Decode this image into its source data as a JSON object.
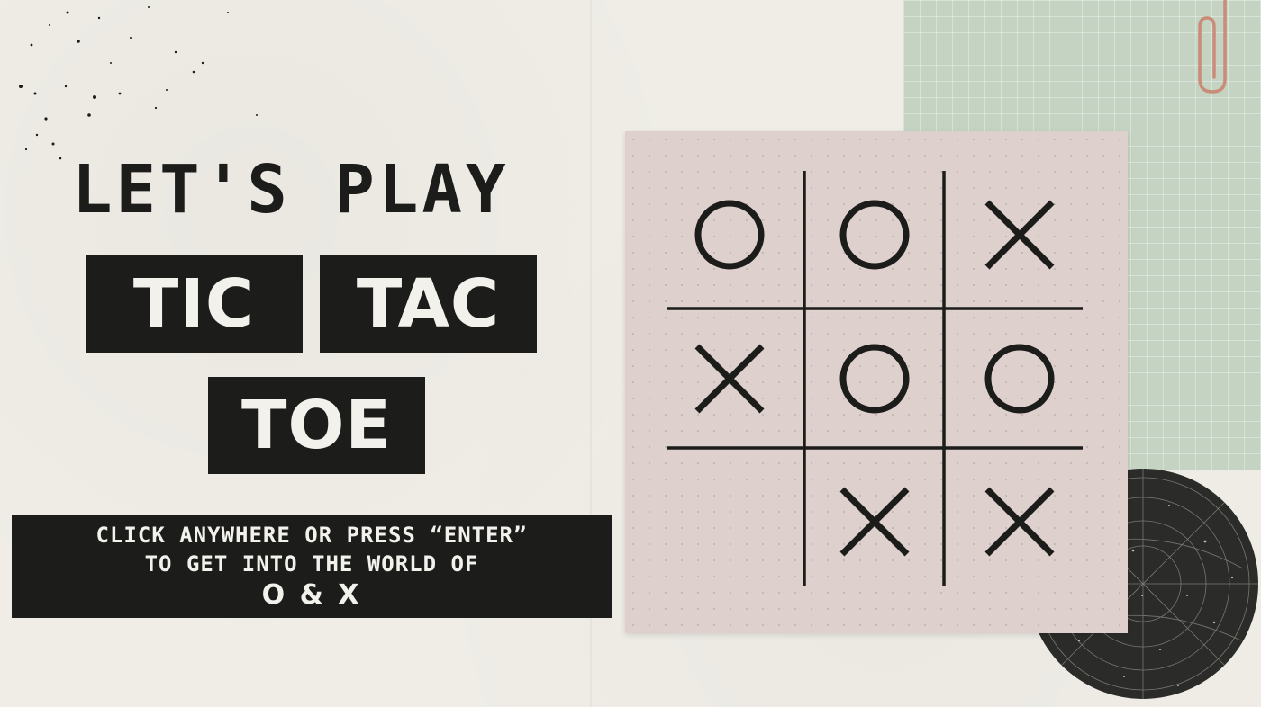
{
  "title": {
    "lets_play": "LET'S PLAY",
    "word1": "TIC",
    "word2": "TAC",
    "word3": "TOE"
  },
  "prompt": {
    "line1": "CLICK ANYWHERE OR PRESS “ENTER”",
    "line2": "TO GET INTO THE WORLD OF",
    "line3": "O & X"
  },
  "board": {
    "cells": [
      "O",
      "O",
      "X",
      "X",
      "O",
      "O",
      "",
      "X",
      "X"
    ]
  },
  "colors": {
    "ink": "#1c1c1a",
    "background": "#efede6",
    "board_paper": "#ddd0cd",
    "grid_paper": "#c5d3c3",
    "paperclip": "#c98c78"
  }
}
